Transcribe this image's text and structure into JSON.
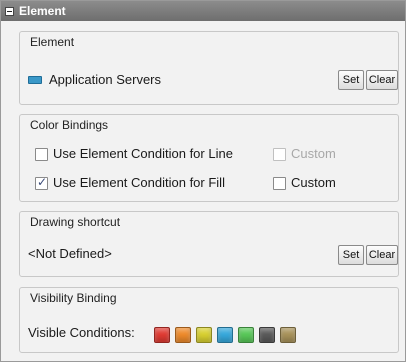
{
  "header": {
    "title": "Element"
  },
  "element_group": {
    "title": "Element",
    "name": "Application Servers",
    "icon": "server-icon",
    "icon_color": "#3a98c8",
    "set_label": "Set",
    "clear_label": "Clear"
  },
  "color_bindings": {
    "title": "Color Bindings",
    "line_label": "Use Element Condition for Line",
    "line_checked": false,
    "line_custom_label": "Custom",
    "line_custom_enabled": false,
    "fill_label": "Use Element Condition for Fill",
    "fill_checked": true,
    "fill_custom_label": "Custom",
    "fill_custom_checked": false
  },
  "drawing_shortcut": {
    "title": "Drawing shortcut",
    "value": "<Not Defined>",
    "set_label": "Set",
    "clear_label": "Clear"
  },
  "visibility": {
    "title": "Visibility Binding",
    "label": "Visible Conditions:",
    "colors": [
      "#e03a32",
      "#ee8a2a",
      "#d8d030",
      "#36a8dc",
      "#58c858",
      "#5a5a5a",
      "#a8925a"
    ]
  }
}
